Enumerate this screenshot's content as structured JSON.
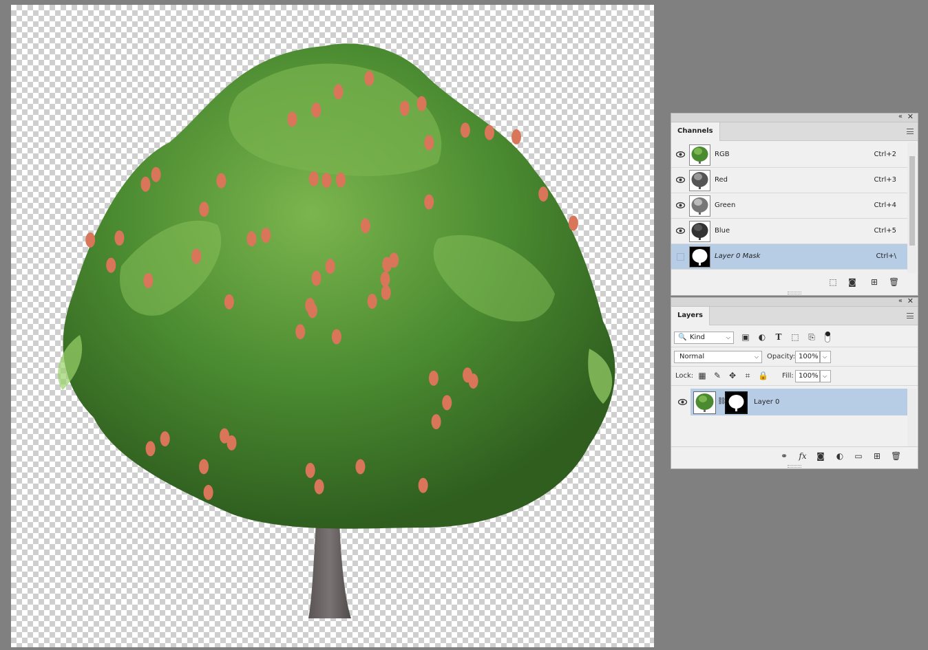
{
  "channels_panel": {
    "tab_label": "Channels",
    "channels": [
      {
        "name": "RGB",
        "shortcut": "Ctrl+2",
        "visible": true,
        "thumb": "color"
      },
      {
        "name": "Red",
        "shortcut": "Ctrl+3",
        "visible": true,
        "thumb": "gray-light"
      },
      {
        "name": "Green",
        "shortcut": "Ctrl+4",
        "visible": true,
        "thumb": "gray-light"
      },
      {
        "name": "Blue",
        "shortcut": "Ctrl+5",
        "visible": true,
        "thumb": "gray-dark"
      },
      {
        "name": "Layer 0 Mask",
        "shortcut": "Ctrl+\\",
        "visible": false,
        "thumb": "mask",
        "selected": true
      }
    ],
    "footer_icons": [
      "load-selection-icon",
      "save-selection-icon",
      "new-channel-icon",
      "delete-icon"
    ]
  },
  "layers_panel": {
    "tab_label": "Layers",
    "filter": {
      "value": "Kind"
    },
    "blend_mode": "Normal",
    "opacity_label": "Opacity:",
    "opacity_value": "100%",
    "lock_label": "Lock:",
    "fill_label": "Fill:",
    "fill_value": "100%",
    "layers": [
      {
        "name": "Layer 0",
        "visible": true,
        "has_mask": true,
        "selected": true
      }
    ],
    "footer_icons": [
      "link-icon",
      "fx-icon",
      "add-mask-icon",
      "adjustment-icon",
      "group-icon",
      "new-layer-icon",
      "delete-icon"
    ]
  },
  "colors": {
    "selection": "#b7cde6",
    "panel_bg": "#f0f0f0",
    "workspace": "#808080",
    "foliage": "#3f7a2a",
    "foliage_light": "#8cc460",
    "fruit": "#d9765a",
    "trunk": "#6e6767"
  }
}
